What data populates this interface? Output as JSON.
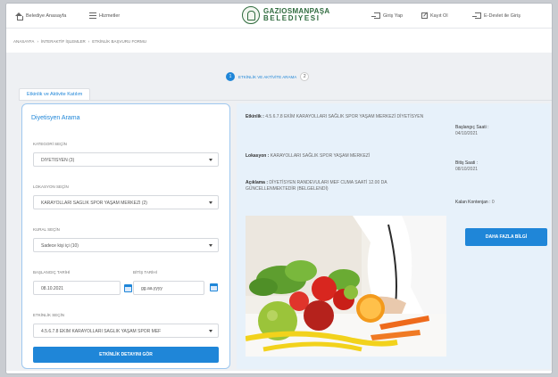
{
  "header": {
    "home_label": "Belediye Anasayfa",
    "menu_label": "Hizmetler",
    "logo_line1": "GAZIOSMANPAŞA",
    "logo_line2": "BELEDIYESI",
    "login_label": "Giriş Yap",
    "register_label": "Kayıt Ol",
    "edevlet_label": "E-Devlet ile Giriş"
  },
  "breadcrumb": [
    "ANASAYFA",
    "İNTERAKTİF İŞLEMLER",
    "ETKİNLİK BAŞVURU FORMU"
  ],
  "steps": {
    "step1_num": "1",
    "step1_label": "ETKİNLİK VE AKTİVİTE ARAMA",
    "step2_num": "2"
  },
  "tab_label": "Etkinlik ve Aktivite Katılım",
  "search": {
    "title": "Diyetisyen Arama",
    "category_label": "KATEGORİ SEÇİN",
    "category_value": "DİYETİSYEN (3)",
    "location_label": "LOKASYON SEÇİN",
    "location_value": "KARAYOLLARI SAĞLIK SPOR YAŞAM MERKEZİ (2)",
    "rule_label": "KURAL SEÇİN",
    "rule_value": "Sadece kişi içi (10)",
    "start_label": "BAŞLANGIÇ TARİHİ",
    "start_value": "08.10.2021",
    "end_label": "BİTİŞ TARİHİ",
    "end_value": "gg.aa.yyyy",
    "event_label": "ETKİNLİK SEÇİN",
    "event_value": "4.5.6.7.8 EKİM KARAYOLLARI SAĞLIK YAŞAM SPOR MEF",
    "show_button": "ETKİNLİK DETAYINI GÖR"
  },
  "detail": {
    "event_key": "Etkinlik :",
    "event_val": "4.5.6.7.8 EKİM KARAYOLLARI SAĞLIK SPOR YAŞAM MERKEZİ DİYETİSYEN",
    "location_key": "Lokasyon :",
    "location_val": "KARAYOLLARI SAĞLIK SPOR YAŞAM MERKEZİ",
    "desc_key": "Açıklama :",
    "desc_val": "DİYETİSYEN RANDEVULARI MEF CUMA SAATİ 12.00 DA GÜNCELLENMEKTEDİR (BELGELENDİ)",
    "start_key": "Başlangıç Saati :",
    "start_val": "04/10/2021",
    "end_key": "Bitiş Saati :",
    "end_val": "08/10/2021",
    "quota_key": "Kalan Kontenjan :",
    "quota_val": "0",
    "more_button": "DAHA FAZLA BİLGİ"
  },
  "colors": {
    "accent": "#1f86d8",
    "panel_bg": "#e7f1fa",
    "logo_green": "#2f6b3e"
  }
}
